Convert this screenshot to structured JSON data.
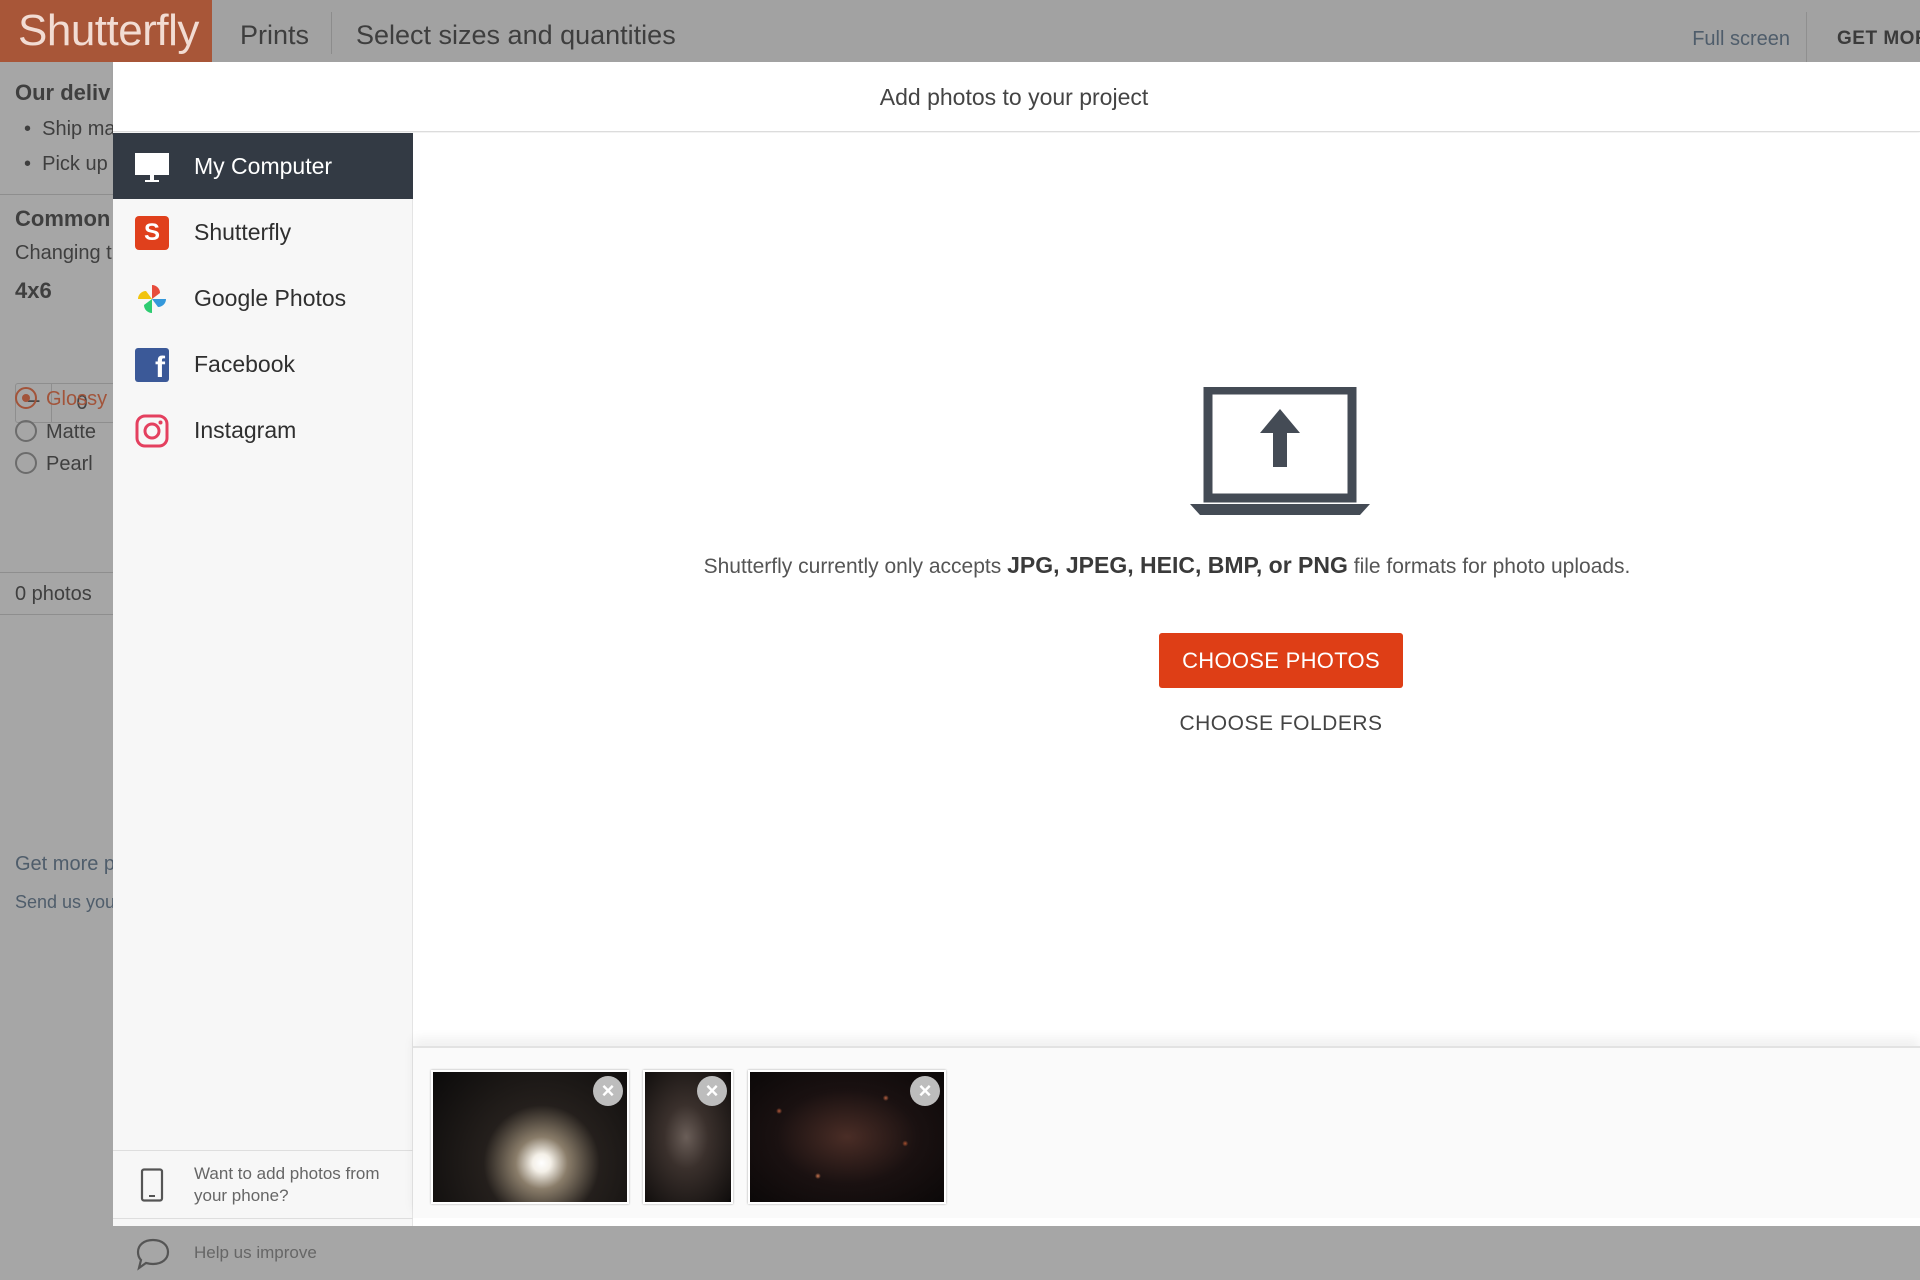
{
  "app": {
    "logo": "Shutterfly",
    "breadcrumb": [
      "Prints",
      "Select sizes and quantities"
    ],
    "full_screen": "Full screen",
    "get_more": "GET MOR"
  },
  "background_panel": {
    "delivery_heading": "Our deliv",
    "delivery_items": [
      "Ship ma",
      "Pick up"
    ],
    "common_heading": "Common",
    "changing_text": "Changing t",
    "size_label": "4x6",
    "quantity": "0",
    "finishes": [
      "Glossy",
      "Matte",
      "Pearl"
    ],
    "selected_finish": "Glossy",
    "photo_count": "0 photos",
    "get_more_link": "Get more p",
    "send_us_link": "Send us you"
  },
  "modal": {
    "title": "Add photos to your project",
    "sources": [
      {
        "label": "My Computer",
        "icon": "monitor-icon",
        "active": true
      },
      {
        "label": "Shutterfly",
        "icon": "shutterfly-icon",
        "active": false
      },
      {
        "label": "Google Photos",
        "icon": "google-photos-icon",
        "active": false
      },
      {
        "label": "Facebook",
        "icon": "facebook-icon",
        "active": false
      },
      {
        "label": "Instagram",
        "icon": "instagram-icon",
        "active": false
      }
    ],
    "phone_prompt": "Want to add photos from your phone?",
    "help_link": "Help us improve",
    "formats_prefix": "Shutterfly currently only accepts ",
    "formats_list": "JPG, JPEG, HEIC, BMP, or PNG",
    "formats_suffix": " file formats for photo uploads.",
    "choose_photos": "CHOOSE PHOTOS",
    "choose_folders": "CHOOSE FOLDERS",
    "remove_symbol": "×",
    "shutterfly_letter": "S",
    "facebook_letter": "f"
  },
  "colors": {
    "brand": "#de3e16",
    "sidebar_active": "#333a44"
  }
}
